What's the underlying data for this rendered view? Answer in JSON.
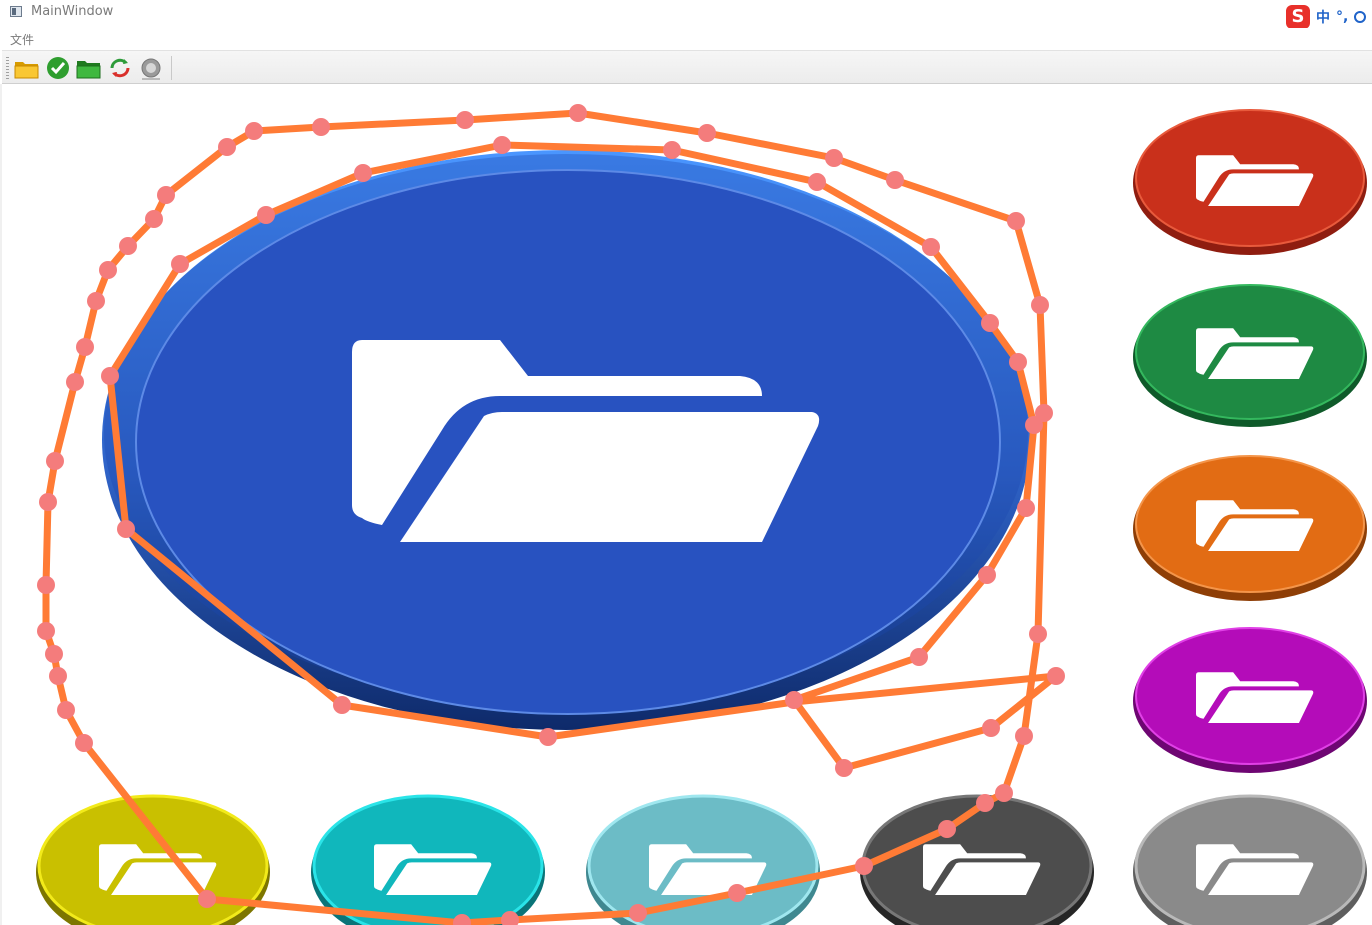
{
  "window": {
    "title": "MainWindow"
  },
  "menu": {
    "file_label": "文件"
  },
  "ime": {
    "logo": "S",
    "mode": "中",
    "punct": "°,"
  },
  "toolbar": {
    "buttons": [
      {
        "icon": "folder-open-icon"
      },
      {
        "icon": "checkmark-icon"
      },
      {
        "icon": "folder-green-icon"
      },
      {
        "icon": "refresh-icon"
      },
      {
        "icon": "back-icon"
      }
    ]
  },
  "colors": {
    "main_folder_button": "#2852c0",
    "red": "#c9301b",
    "green": "#1e8a43",
    "orange": "#e26c14",
    "magenta": "#b40cb9",
    "yellow": "#c9c000",
    "cyan": "#10b7bc",
    "teal_light": "#6cbcc6",
    "dark_gray": "#4d4d4d",
    "light_gray": "#8a8a8a",
    "annotation_line": "#ff7b35",
    "annotation_point": "#f47c7c"
  }
}
